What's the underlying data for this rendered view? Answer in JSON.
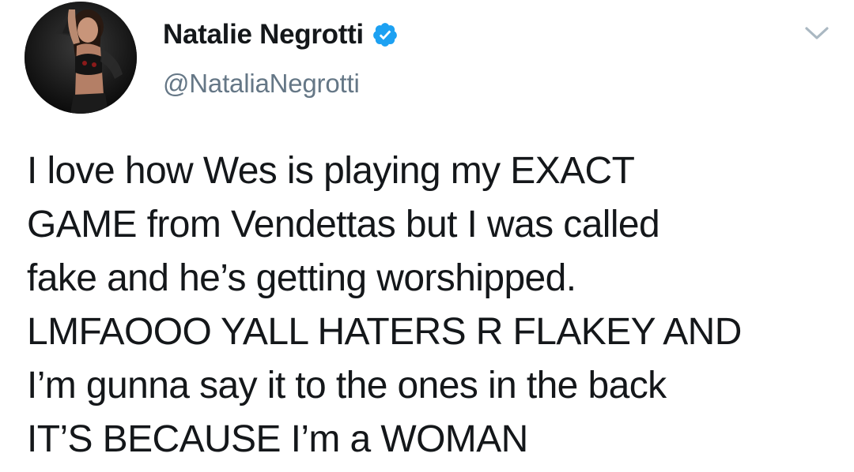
{
  "tweet": {
    "author": {
      "display_name": "Natalie Negrotti",
      "handle": "@NataliaNegrotti",
      "verified": true,
      "verified_icon": "verified-badge-icon",
      "verified_color": "#1da1f2"
    },
    "menu_icon": "chevron-down-icon",
    "menu_icon_color": "#aab8c2",
    "text_lines": [
      "I love how Wes is playing my EXACT",
      "GAME from Vendettas but I was called",
      "fake and he’s getting worshipped.",
      "LMFAOOO YALL HATERS R FLAKEY AND",
      "I’m gunna say it to the ones in the back",
      "IT’S BECAUSE I’m a WOMAN"
    ]
  }
}
